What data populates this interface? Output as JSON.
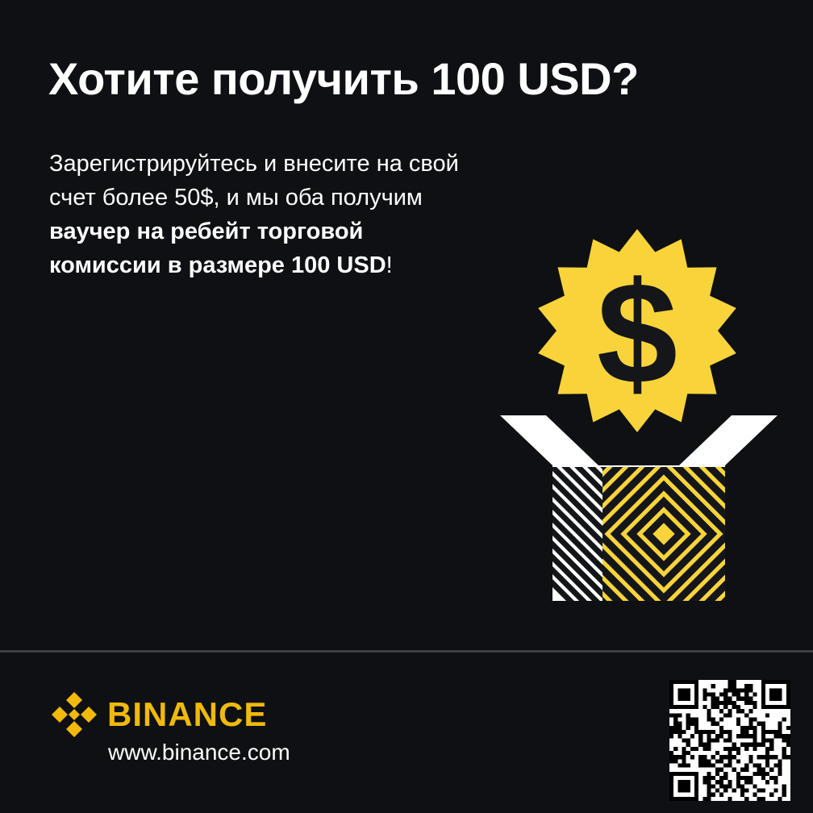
{
  "headline": "Хотите получить 100 USD?",
  "body": {
    "intro": "Зарегистрируйтесь и внесите на свой счет более 50$, и мы оба получим ",
    "highlight": "ваучер на ребейт торговой комиссии в размере 100 USD",
    "outro": "!"
  },
  "illustration": {
    "badge_symbol": "$",
    "badge_icon": "dollar-badge-icon",
    "box_icon": "open-gift-box-icon"
  },
  "footer": {
    "logo_icon": "binance-diamond-logo-icon",
    "brand_name": "BINANCE",
    "url": "www.binance.com",
    "qr_icon": "qr-code-icon"
  },
  "colors": {
    "background": "#0e1013",
    "accent_yellow": "#f8d33a",
    "brand_yellow": "#f0b90b",
    "text": "#ffffff",
    "divider": "#3d4046"
  }
}
